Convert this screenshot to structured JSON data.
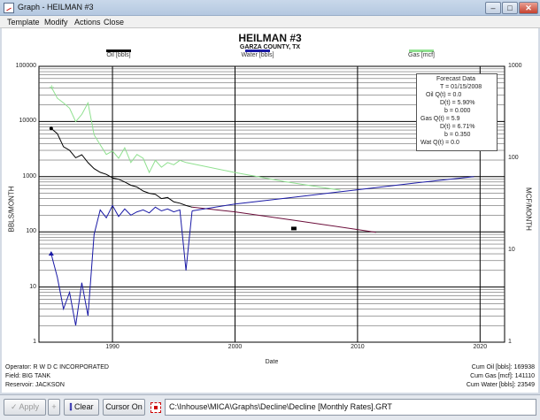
{
  "window": {
    "title": "Graph - HEILMAN #3"
  },
  "menu": [
    "Template",
    "Modify",
    "Actions",
    "Close"
  ],
  "chart_data": {
    "type": "line",
    "title": "HEILMAN #3",
    "subtitle": "GARZA COUNTY, TX",
    "xlabel": "Date",
    "ylabel_left": "BBLS/MONTH",
    "ylabel_right": "MCF/MONTH",
    "y_scale": "log",
    "ylim_left": [
      1,
      100000
    ],
    "ylim_right": [
      1,
      1000
    ],
    "xlim": [
      1984,
      2022
    ],
    "x_ticks": [
      "1990",
      "2000",
      "2010",
      "2020"
    ],
    "y_ticks_left": [
      "100000",
      "10000",
      "1000",
      "100",
      "10"
    ],
    "y_ticks_right": [
      "1000",
      "100",
      "10",
      "1"
    ],
    "legend": [
      {
        "name": "Oil [bbls]",
        "color": "#000000"
      },
      {
        "name": "Water [bbls]",
        "color": "#1a1aa6"
      },
      {
        "name": "Gas [mcf]",
        "color": "#8fe08f"
      }
    ],
    "series": [
      {
        "name": "Oil [bbls]",
        "axis": "left",
        "color": "#000000",
        "x": [
          1985.0,
          1985.5,
          1986.0,
          1986.5,
          1987.0,
          1987.5,
          1988.0,
          1988.5,
          1989.0,
          1989.5,
          1990.0,
          1990.5,
          1991.0,
          1991.5,
          1992.0,
          1992.5,
          1993.0,
          1993.5,
          1994.0,
          1994.5,
          1995.0,
          1995.5,
          1996.0,
          1996.5
        ],
        "y": [
          7500,
          6000,
          3500,
          3000,
          2200,
          2500,
          1800,
          1400,
          1200,
          1100,
          950,
          900,
          800,
          700,
          650,
          550,
          500,
          480,
          400,
          420,
          350,
          330,
          300,
          280
        ]
      },
      {
        "name": "Water [bbls]",
        "axis": "left",
        "color": "#1a1aa6",
        "x": [
          1985.0,
          1985.5,
          1986.0,
          1986.5,
          1987.0,
          1987.5,
          1988.0,
          1988.5,
          1989.0,
          1989.5,
          1990.0,
          1990.5,
          1991.0,
          1991.5,
          1992.0,
          1992.5,
          1993.0,
          1993.5,
          1994.0,
          1994.5,
          1995.0,
          1995.5,
          1996.0,
          1996.5
        ],
        "y": [
          40,
          15,
          4,
          8,
          2,
          12,
          3,
          90,
          250,
          180,
          300,
          190,
          260,
          200,
          230,
          250,
          220,
          280,
          240,
          260,
          230,
          250,
          20,
          240
        ]
      },
      {
        "name": "Gas [mcf]",
        "axis": "right",
        "color": "#8fe08f",
        "x": [
          1985.0,
          1985.5,
          1986.0,
          1986.5,
          1987.0,
          1987.5,
          1988.0,
          1988.5,
          1989.0,
          1989.5,
          1990.0,
          1990.5,
          1991.0,
          1991.5,
          1992.0,
          1992.5,
          1993.0,
          1993.5,
          1994.0,
          1994.5,
          1995.0,
          1995.5,
          1996.0
        ],
        "y": [
          600,
          450,
          400,
          350,
          250,
          300,
          400,
          180,
          140,
          110,
          120,
          100,
          130,
          90,
          110,
          100,
          70,
          95,
          80,
          90,
          85,
          95,
          90
        ]
      },
      {
        "name": "Oil forecast",
        "axis": "left",
        "color": "#6b0d3a",
        "x": [
          1996.5,
          2000.0,
          2005.0,
          2010.0,
          2011.5
        ],
        "y": [
          280,
          230,
          160,
          110,
          98
        ]
      },
      {
        "name": "Water forecast",
        "axis": "left",
        "color": "#1a1aa6",
        "x": [
          1996.5,
          2000.0,
          2005.0,
          2010.0,
          2015.0,
          2019.5
        ],
        "y": [
          240,
          320,
          430,
          580,
          780,
          1000
        ]
      },
      {
        "name": "Gas forecast",
        "axis": "right",
        "color": "#8fe08f",
        "x": [
          1996.0,
          2000.0,
          2004.0,
          2008.6
        ],
        "y": [
          90,
          70,
          56,
          45
        ]
      }
    ],
    "markers": [
      {
        "name": "forecast-end-marker",
        "x": 2004.8,
        "y": 115,
        "axis": "left"
      }
    ]
  },
  "forecast": {
    "title": "Forecast Data",
    "lines": [
      "T = 01/15/2008",
      "Oil Q(t) = 0.0",
      "D(t) = 5.90%",
      "b = 0.000",
      "Gas Q(t) = 5.9",
      "D(t) = 6.71%",
      "b = 0.350",
      "Wat Q(t) = 0.0"
    ]
  },
  "footer": {
    "operator": "Operator: R W D C INCORPORATED",
    "field": "Field: BIG TANK",
    "reservoir": "Reservoir: JACKSON",
    "cum_oil": "Cum Oil [bbls]: 169938",
    "cum_gas": "Cum Gas [mcf]: 141110",
    "cum_water": "Cum Water [bbls]: 23549"
  },
  "toolbar": {
    "apply_label": "Apply",
    "plus_label": "+",
    "clear_label": "Clear",
    "cursor_label": "Cursor On",
    "path": "C:\\Inhouse\\MICA\\Graphs\\Decline\\Decline [Monthly Rates].GRT"
  }
}
